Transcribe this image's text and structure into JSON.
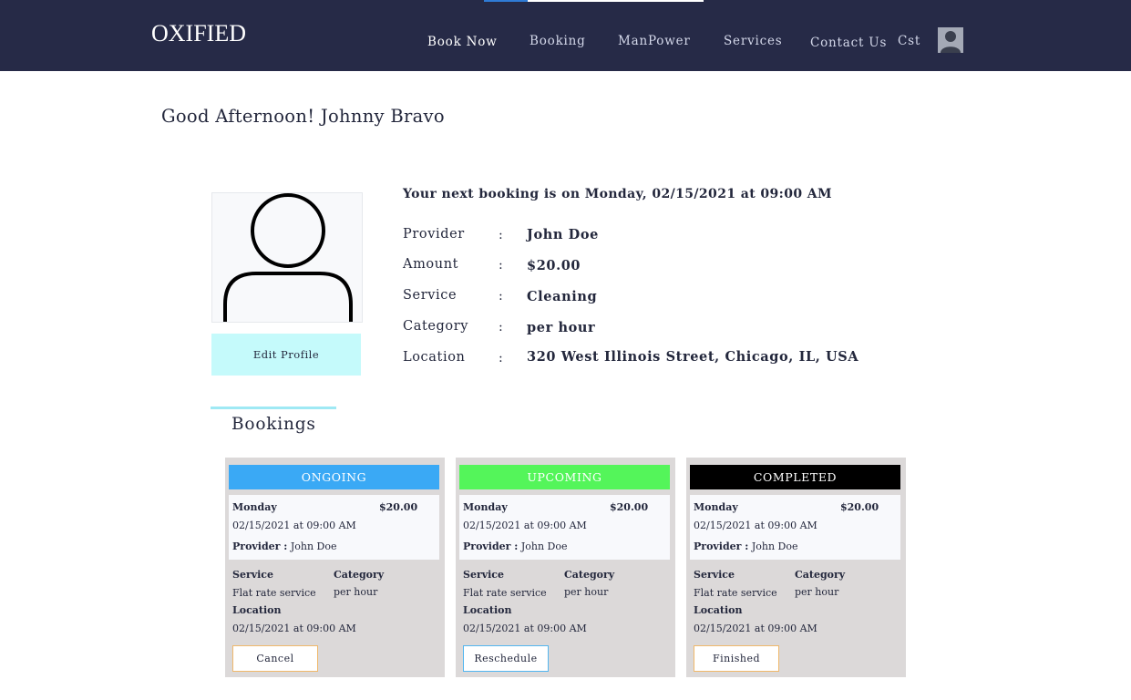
{
  "header": {
    "logo": "OXIFIED",
    "nav": [
      "Book Now",
      "Booking",
      "ManPower",
      "Services",
      "Contact Us"
    ],
    "user_short": "Cst"
  },
  "greeting": "Good Afternoon! Johnny Bravo",
  "profile": {
    "edit_label": "Edit Profile"
  },
  "next_booking": {
    "title": "Your next booking is on Monday, 02/15/2021 at 09:00 AM",
    "rows": [
      {
        "label": "Provider",
        "value": "John Doe"
      },
      {
        "label": "Amount",
        "value": "$20.00"
      },
      {
        "label": "Service",
        "value": "Cleaning"
      },
      {
        "label": "Category",
        "value": "per hour"
      },
      {
        "label": "Location",
        "value": "320 West Illinois Street, Chicago, IL, USA"
      }
    ]
  },
  "bookings_tab": "Bookings",
  "cards": [
    {
      "status": "ONGOING",
      "status_color": "#3aa9f5",
      "day": "Monday",
      "amount": "$20.00",
      "datetime": "02/15/2021 at 09:00 AM",
      "provider_label": "Provider :",
      "provider": "John Doe",
      "service_label": "Service",
      "service": "Flat rate service",
      "category_label": "Category",
      "category": "per hour",
      "location_label": "Location",
      "location": "02/15/2021 at 09:00 AM",
      "action": "Cancel",
      "action_border": "#f0b86a"
    },
    {
      "status": "UPCOMING",
      "status_color": "#54f55a",
      "day": "Monday",
      "amount": "$20.00",
      "datetime": "02/15/2021 at 09:00 AM",
      "provider_label": "Provider :",
      "provider": "John Doe",
      "service_label": "Service",
      "service": "Flat rate service",
      "category_label": "Category",
      "category": "per hour",
      "location_label": "Location",
      "location": "02/15/2021 at 09:00 AM",
      "action": "Reschedule",
      "action_border": "#52b6f0"
    },
    {
      "status": "COMPLETED",
      "status_color": "#000000",
      "day": "Monday",
      "amount": "$20.00",
      "datetime": "02/15/2021 at 09:00 AM",
      "provider_label": "Provider :",
      "provider": "John Doe",
      "service_label": "Service",
      "service": "Flat rate service",
      "category_label": "Category",
      "category": "per hour",
      "location_label": "Location",
      "location": "02/15/2021 at 09:00 AM",
      "action": "Finished",
      "action_border": "#f0b86a"
    }
  ]
}
